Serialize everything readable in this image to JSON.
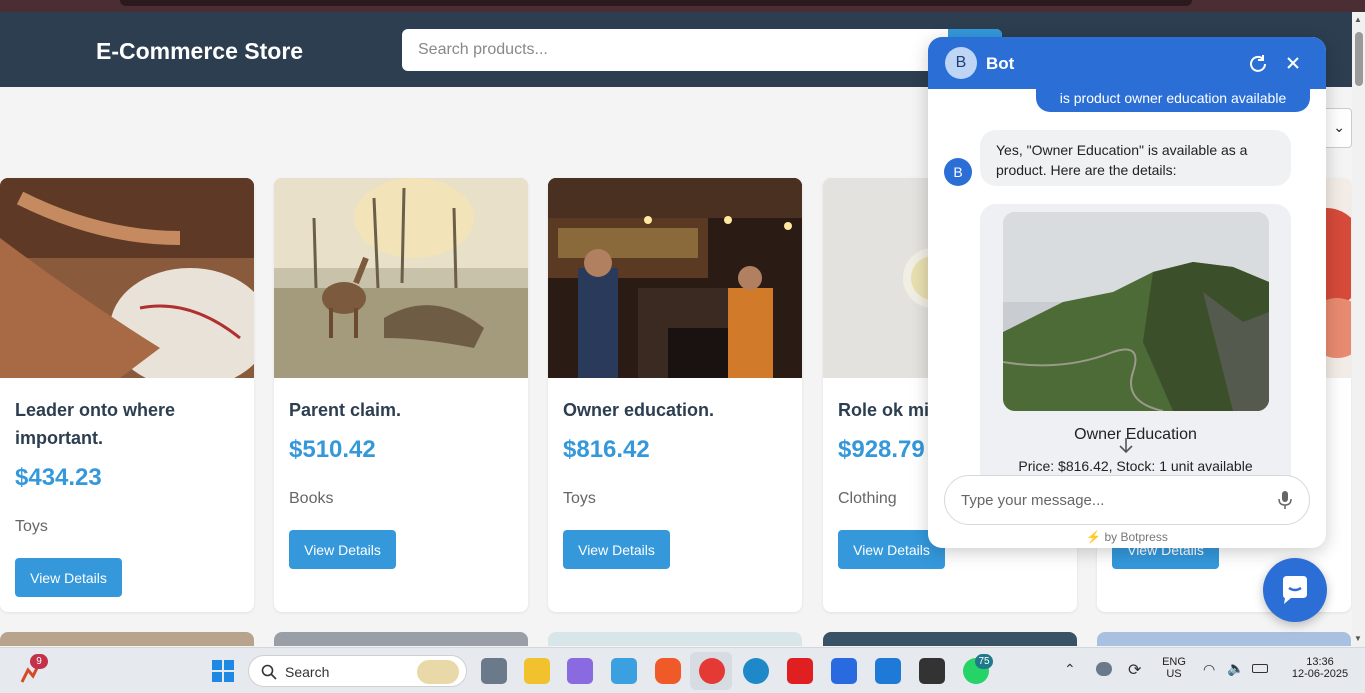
{
  "header": {
    "brand": "E-Commerce Store",
    "search_placeholder": "Search products..."
  },
  "products": [
    {
      "title": "Leader onto where important.",
      "price": "$434.23",
      "category": "Toys",
      "button": "View Details"
    },
    {
      "title": "Parent claim.",
      "price": "$510.42",
      "category": "Books",
      "button": "View Details"
    },
    {
      "title": "Owner education.",
      "price": "$816.42",
      "category": "Toys",
      "button": "View Details"
    },
    {
      "title": "Role ok mi",
      "price": "$928.79",
      "category": "Clothing",
      "button": "View Details"
    },
    {
      "title": "",
      "price": "",
      "category": "",
      "button": "View Details"
    }
  ],
  "chat": {
    "bot_initial": "B",
    "bot_name": "Bot",
    "user_message": "is product owner education available",
    "bot_message": "Yes, \"Owner Education\" is available as a product. Here are the details:",
    "product_name": "Owner Education",
    "product_meta": "Price: $816.42, Stock: 1 unit available",
    "input_placeholder": "Type your message...",
    "powered_by": "by Botpress"
  },
  "taskbar": {
    "notification_count": "9",
    "search_label": "Search",
    "whatsapp_badge": "75",
    "language_top": "ENG",
    "language_bottom": "US",
    "time": "13:36",
    "date": "12-06-2025"
  },
  "colors": {
    "header_bg": "#2c3e50",
    "accent": "#3498db",
    "chat_blue": "#2b6fd6"
  }
}
